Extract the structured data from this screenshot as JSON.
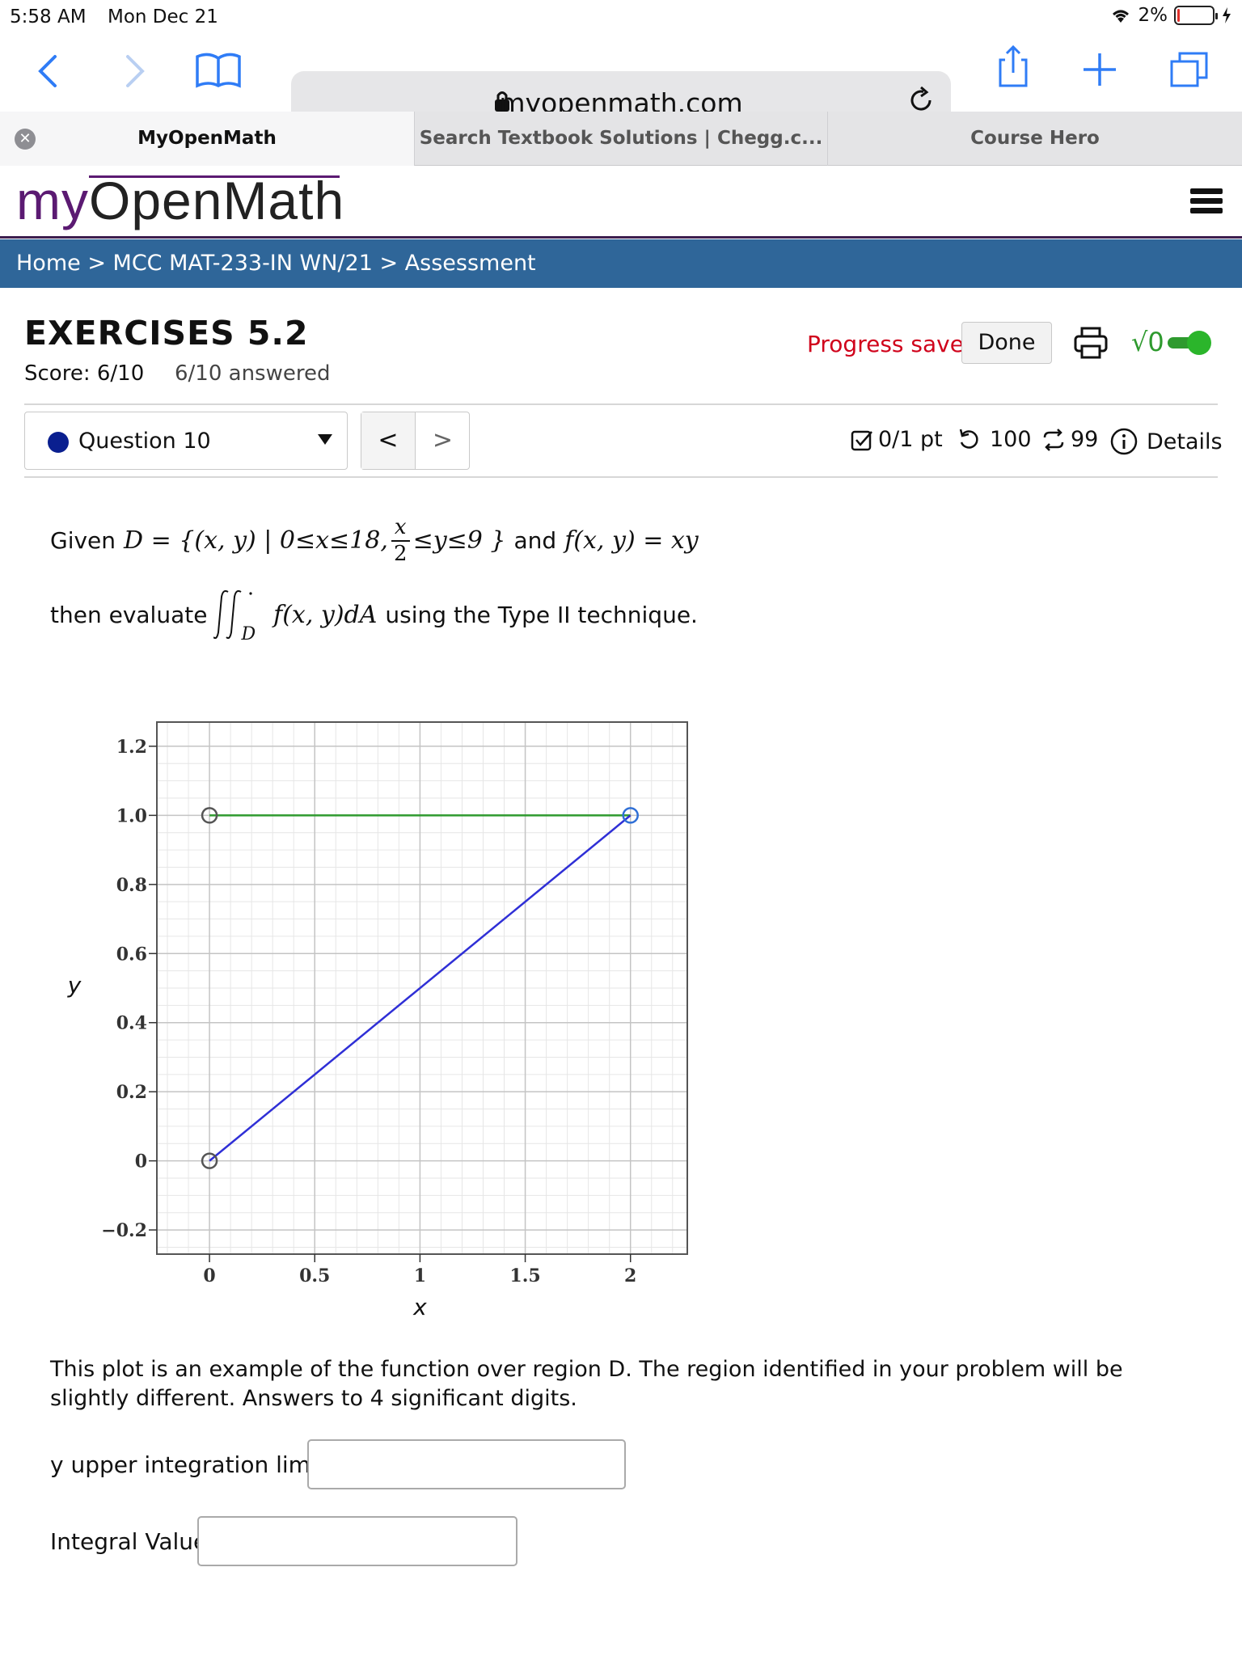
{
  "status_bar": {
    "time": "5:58 AM",
    "date": "Mon Dec 21",
    "battery": "2%"
  },
  "browser": {
    "url": "myopenmath.com"
  },
  "tabs": [
    {
      "label": "MyOpenMath"
    },
    {
      "label": "Search Textbook Solutions | Chegg.c..."
    },
    {
      "label": "Course Hero"
    }
  ],
  "site": {
    "logo_my": "my",
    "logo_rest": "OpenMath"
  },
  "breadcrumb": "Home > MCC MAT-233-IN WN/21 > Assessment",
  "assessment": {
    "title": "EXERCISES 5.2",
    "score": "Score: 6/10",
    "answered": "6/10 answered",
    "progress_saved": "Progress saved",
    "done_label": "Done",
    "sqrt_label": "√0"
  },
  "question_nav": {
    "selected": "Question 10",
    "prev": "<",
    "next": ">",
    "points": "0/1 pt",
    "retries": "100",
    "attempts": "99",
    "details": "Details"
  },
  "question": {
    "given_prefix": "Given",
    "set_D": "D = {(x, y) | 0≤x≤18,",
    "frac_num": "x",
    "frac_den": "2",
    "set_rest": "≤y≤9 }",
    "and": "and",
    "func": "f(x, y) = xy",
    "then_evaluate": "then evaluate",
    "integrand": "f(x, y)dA",
    "integral_sub": "D",
    "technique": "using the Type II technique."
  },
  "chart_data": {
    "type": "line",
    "xlabel": "x",
    "ylabel": "y",
    "xlim": [
      -0.25,
      2.27
    ],
    "ylim": [
      -0.27,
      1.27
    ],
    "x_ticks": [
      "0",
      "0.5",
      "1",
      "1.5",
      "2"
    ],
    "y_ticks": [
      "1.2",
      "1.0",
      "0.8",
      "0.6",
      "0.4",
      "0.2",
      "0",
      "−0.2"
    ],
    "grid": true,
    "series": [
      {
        "points": [
          [
            0,
            1
          ],
          [
            2,
            1
          ]
        ],
        "color": "#2e9a2e"
      },
      {
        "points": [
          [
            0,
            0
          ],
          [
            2,
            1
          ]
        ],
        "color": "#2f2fd6"
      }
    ],
    "open_points": [
      {
        "x": 0,
        "y": 1,
        "color": "#555555"
      },
      {
        "x": 2,
        "y": 1,
        "color": "#2f6fd6"
      },
      {
        "x": 0,
        "y": 0,
        "color": "#555555"
      }
    ]
  },
  "note": "This plot is an example of the function over region D.  The region identified in your problem will be slightly different. Answers to  4 significant digits.",
  "fields": {
    "y_upper_label": "y upper integration limit",
    "y_upper_value": "",
    "integral_label": "Integral Value",
    "integral_value": ""
  }
}
